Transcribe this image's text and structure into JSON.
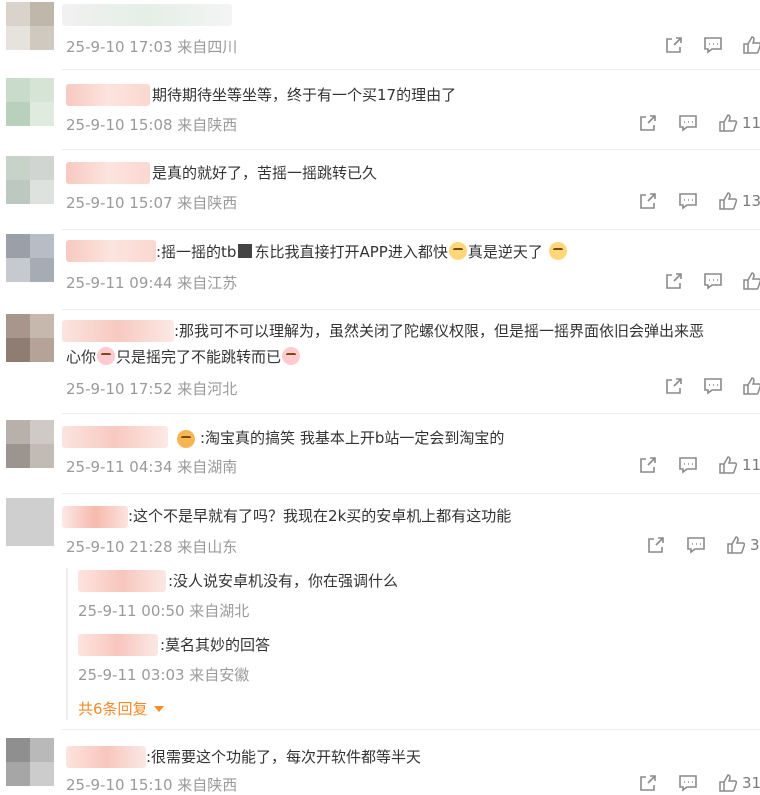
{
  "comments": [
    {
      "text": "",
      "meta": "25-9-10 17:03 来自四川",
      "likes": ""
    },
    {
      "text": "期待期待坐等坐等，终于有一个买17的理由了",
      "meta": "25-9-10 15:08 来自陕西",
      "likes": "11"
    },
    {
      "text": "是真的就好了，苦摇一摇跳转已久",
      "meta": "25-9-10 15:07 来自陕西",
      "likes": "13"
    },
    {
      "text_a": ":摇一摇的tb",
      "text_b": "东比我直接打开APP进入都快",
      "text_c": "真是逆天了",
      "meta": "25-9-11 09:44 来自江苏",
      "likes": ""
    },
    {
      "text_line1": ":那我可不可以理解为，虽然关闭了陀螺仪权限，但是摇一摇界面依旧会弹出来恶",
      "text_line2_a": "心你",
      "text_line2_b": "只是摇完了不能跳转而已",
      "meta": "25-9-10 17:52 来自河北",
      "likes": ""
    },
    {
      "text": ":淘宝真的搞笑 我基本上开b站一定会到淘宝的",
      "meta": "25-9-11 04:34 来自湖南",
      "likes": "11"
    },
    {
      "text": ":这个不是早就有了吗？我现在2k买的安卓机上都有这功能",
      "meta": "25-9-10 21:28 来自山东",
      "likes": "3",
      "replies": [
        {
          "text": ":没人说安卓机没有，你在强调什么",
          "meta": "25-9-11 00:50 来自湖北"
        },
        {
          "text": ":莫名其妙的回答",
          "meta": "25-9-11 03:03 来自安徽"
        }
      ],
      "more": "共6条回复"
    },
    {
      "text": ":很需要这个功能了，每次开软件都等半天",
      "meta": "25-9-10 15:10 来自陕西",
      "likes": "31"
    }
  ]
}
